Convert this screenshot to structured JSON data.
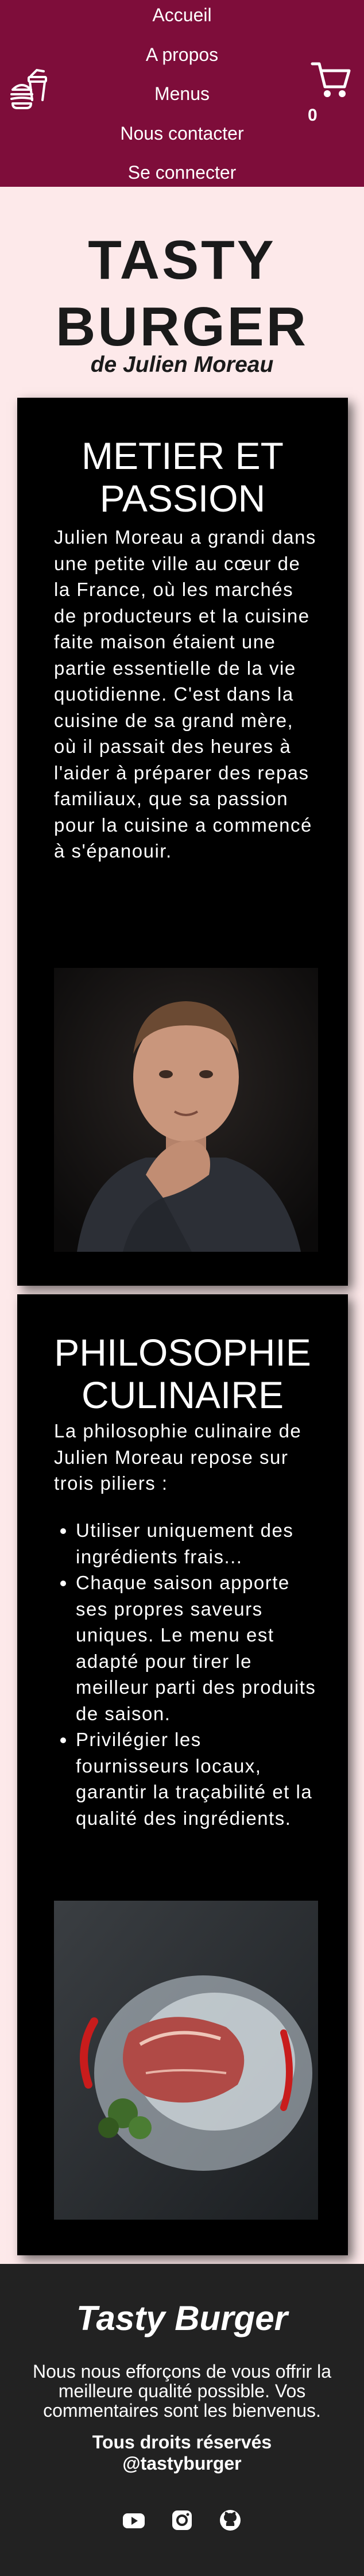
{
  "header": {
    "nav": [
      "Accueil",
      "A propos",
      "Menus",
      "Nous contacter",
      "Se connecter"
    ],
    "cart_count": "0",
    "logo_icon": "burger-icon",
    "cart_icon": "cart-icon",
    "background": "#7e0d3a"
  },
  "hero": {
    "title_line1": "TASTY",
    "title_line2": "BURGER",
    "subtitle": "de Julien Moreau"
  },
  "section1": {
    "title": "METIER ET PASSION",
    "text": "Julien Moreau a grandi dans une petite ville au cœur de la France, où les marchés de producteurs et la cuisine faite maison étaient une partie essentielle de la vie quotidienne. C'est dans la cuisine de sa grand mère, où il passait des heures à l'aider à préparer des repas familiaux, que sa passion pour la cuisine a commencé à s'épanouir."
  },
  "section2": {
    "title": "PHILOSOPHIE CULINAIRE",
    "intro": "La philosophie culinaire de Julien Moreau repose sur trois piliers :",
    "bullets": [
      "Utiliser uniquement des ingrédients frais...",
      "Chaque saison apporte ses propres saveurs uniques. Le menu est adapté pour tirer le meilleur parti des produits de saison.",
      "Privilégier les fournisseurs locaux, garantir la traçabilité et la qualité des ingrédients."
    ]
  },
  "footer": {
    "title": "Tasty Burger",
    "text": "Nous nous efforçons de vous offrir la meilleure qualité possible. Vos commentaires sont les bienvenus.",
    "rights_line1": "Tous droits réservés",
    "rights_line2": "@tastyburger",
    "socials": [
      "youtube-icon",
      "instagram-icon",
      "github-icon"
    ]
  }
}
